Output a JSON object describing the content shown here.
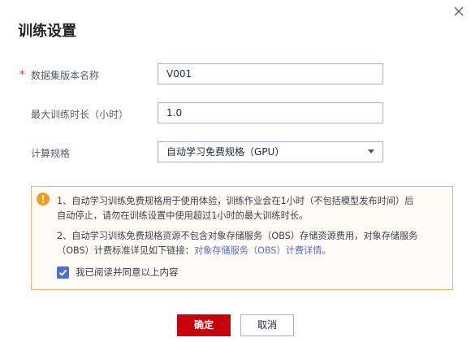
{
  "dialog": {
    "title": "训练设置",
    "close_icon": "close-icon"
  },
  "form": {
    "dataset_version": {
      "label": "数据集版本名称",
      "required_mark": "*",
      "value": "V001"
    },
    "max_duration": {
      "label": "最大训练时长（小时）",
      "value": "1.0"
    },
    "spec": {
      "label": "计算规格",
      "selected": "自动学习免费规格（GPU）"
    }
  },
  "notice": {
    "icon": "warning-icon",
    "line1": "1、自动学习训练免费规格用于使用体验，训练作业会在1小时（不包括模型发布时间）后",
    "line2": "自动停止，请勿在训练设置中使用超过1小时的最大训练时长。",
    "line3": "2、自动学习训练免费规格资源不包含对象存储服务（OBS）存储资源费用，对象存储服务",
    "line4_prefix": "（OBS）计费标准详见如下链接：",
    "link": "对象存储服务（OBS）计费详情。",
    "agree_label": "我已阅读并同意以上内容",
    "agree_checked": true
  },
  "buttons": {
    "confirm": "确定",
    "cancel": "取消"
  },
  "colors": {
    "primary": "#c7000b",
    "link": "#526ecc",
    "warning": "#f59a23",
    "notice_border": "#f3b073"
  }
}
